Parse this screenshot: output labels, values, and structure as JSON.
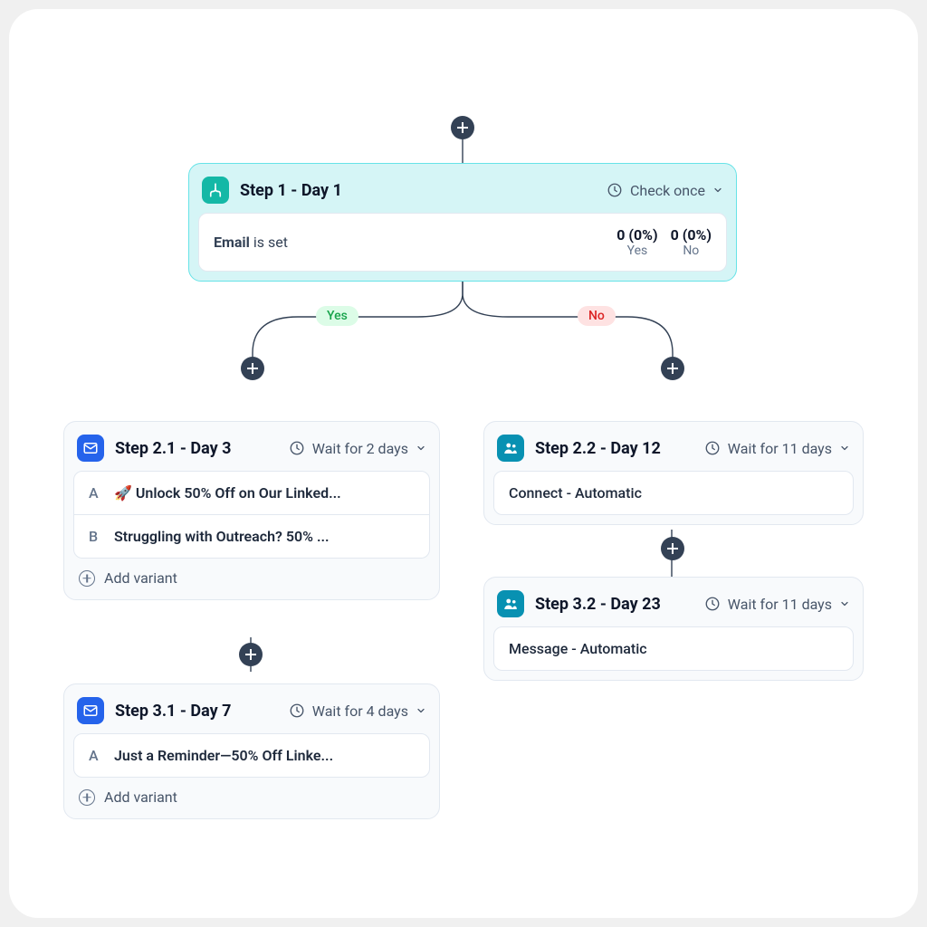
{
  "branch_labels": {
    "yes": "Yes",
    "no": "No"
  },
  "step1": {
    "title": "Step 1 - Day 1",
    "wait": "Check once",
    "condition_strong": "Email",
    "condition_rest": " is set",
    "stats": {
      "yes_num": "0 (0%)",
      "yes_lbl": "Yes",
      "no_num": "0 (0%)",
      "no_lbl": "No"
    }
  },
  "step21": {
    "title": "Step 2.1 - Day 3",
    "wait": "Wait for 2 days",
    "variants": {
      "a_letter": "A",
      "a_text": "🚀 Unlock 50% Off on Our Linked...",
      "b_letter": "B",
      "b_text": "Struggling with Outreach? 50% ..."
    },
    "add": "Add variant"
  },
  "step31": {
    "title": "Step 3.1 - Day 7",
    "wait": "Wait for 4 days",
    "variants": {
      "a_letter": "A",
      "a_text": "Just a Reminder—50% Off Linke..."
    },
    "add": "Add variant"
  },
  "step22": {
    "title": "Step 2.2 - Day 12",
    "wait": "Wait for 11 days",
    "body": "Connect - Automatic"
  },
  "step32": {
    "title": "Step 3.2 - Day 23",
    "wait": "Wait for 11 days",
    "body": "Message - Automatic"
  }
}
